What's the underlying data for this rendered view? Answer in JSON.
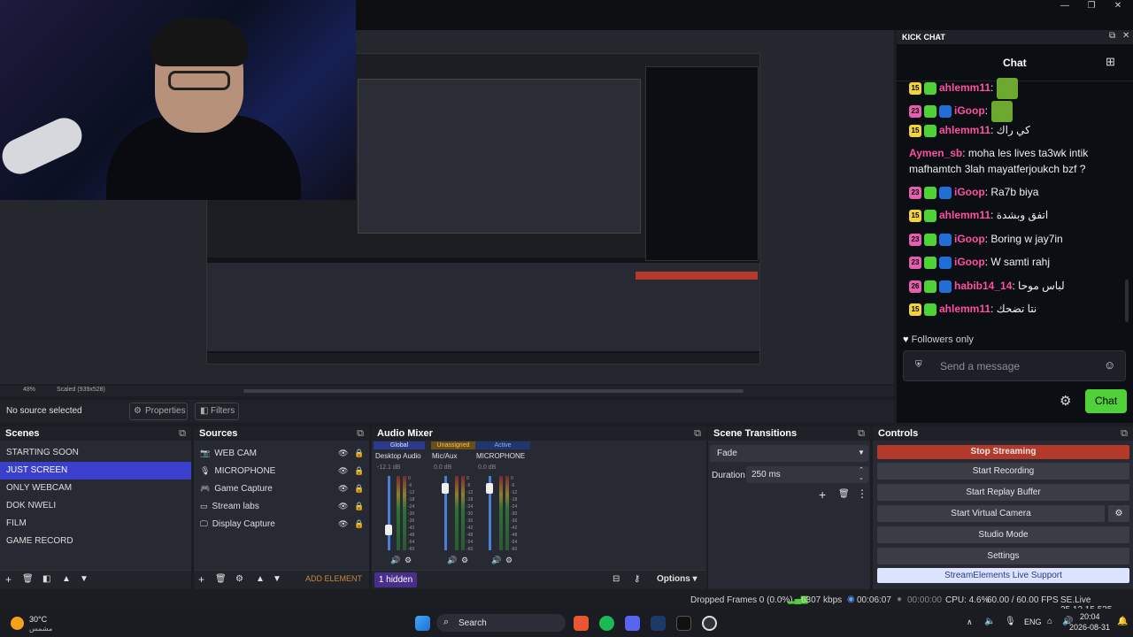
{
  "window": {
    "minimize": "—",
    "restore": "❐",
    "close": "✕"
  },
  "chat": {
    "dock_title": "KICK CHAT",
    "header": "Chat",
    "messages": [
      {
        "badge": "15",
        "badge_color": "#f2d33a",
        "user": "ahlemm11",
        "user_color": "#ff4fa3",
        "text": ":"
      },
      {
        "badge": "23",
        "badge_color": "#e75db0",
        "user": "iGoop",
        "user_color": "#ff4fa3",
        "text": ":"
      },
      {
        "badge": "15",
        "badge_color": "#f2d33a",
        "user": "ahlemm11",
        "user_color": "#ff4fa3",
        "text": ": كي راك"
      },
      {
        "badge": "",
        "badge_color": "",
        "user": "Aymen_sb",
        "user_color": "#ff4fa3",
        "text": ": moha les lives ta3wk intik"
      },
      {
        "badge": "",
        "badge_color": "",
        "user": "",
        "user_color": "",
        "text": "mafhamtch 3lah mayatferjoukch bzf ?"
      },
      {
        "badge": "23",
        "badge_color": "#e75db0",
        "user": "iGoop",
        "user_color": "#ff4fa3",
        "text": ": Ra7b biya"
      },
      {
        "badge": "15",
        "badge_color": "#f2d33a",
        "user": "ahlemm11",
        "user_color": "#ff4fa3",
        "text": ": اتفق وبشدة"
      },
      {
        "badge": "23",
        "badge_color": "#e75db0",
        "user": "iGoop",
        "user_color": "#ff4fa3",
        "text": ": Boring w jay7in"
      },
      {
        "badge": "23",
        "badge_color": "#e75db0",
        "user": "iGoop",
        "user_color": "#ff4fa3",
        "text": ": W samti rahj"
      },
      {
        "badge": "26",
        "badge_color": "#e75db0",
        "user": "habib14_14",
        "user_color": "#ff4fa3",
        "text": ": لباس موحا"
      },
      {
        "badge": "15",
        "badge_color": "#f2d33a",
        "user": "ahlemm11",
        "user_color": "#ff4fa3",
        "text": ": نتا تضحك"
      }
    ],
    "followers_only": "Followers only",
    "input_placeholder": "Send a message",
    "send_label": "Chat"
  },
  "preview": {
    "zoom": "48%",
    "scale": "Scaled (939x528)"
  },
  "sourcebar": {
    "status": "No source selected",
    "properties": "Properties",
    "filters": "Filters"
  },
  "scenes": {
    "title": "Scenes",
    "items": [
      "STARTING SOON",
      "JUST SCREEN",
      "ONLY WEBCAM",
      "DOK NWELI",
      "FILM",
      "GAME RECORD"
    ],
    "selected": "JUST SCREEN"
  },
  "sources": {
    "title": "Sources",
    "items": [
      "WEB CAM",
      "MICROPHONE",
      "Game Capture",
      "Stream labs",
      "Display Capture"
    ],
    "add_element": "ADD ELEMENT",
    "hidden": "1 hidden"
  },
  "mixer": {
    "title": "Audio Mixer",
    "groups": [
      "Global",
      "Unassigned",
      "Active"
    ],
    "channels": [
      {
        "name": "Desktop Audio",
        "db": "-12.1 dB",
        "level": 0.35
      },
      {
        "name": "Mic/Aux",
        "db": "0.0 dB",
        "level": 0.9
      },
      {
        "name": "MICROPHONE",
        "db": "0.0 dB",
        "level": 0.9
      }
    ],
    "scale": [
      "0",
      "-6",
      "-12",
      "-18",
      "-24",
      "-30",
      "-36",
      "-42",
      "-48",
      "-54",
      "-60"
    ],
    "options": "Options"
  },
  "transitions": {
    "title": "Scene Transitions",
    "selected": "Fade",
    "duration_label": "Duration",
    "duration": "250 ms"
  },
  "controls": {
    "title": "Controls",
    "stop_streaming": "Stop Streaming",
    "start_recording": "Start Recording",
    "start_replay": "Start Replay Buffer",
    "start_virtual": "Start Virtual Camera",
    "studio_mode": "Studio Mode",
    "settings": "Settings",
    "streamelements": "StreamElements Live Support"
  },
  "status": {
    "dropped": "Dropped Frames 0 (0.0%)",
    "kbps": "6307 kbps",
    "stream_time": "00:06:07",
    "rec_time": "00:00:00",
    "cpu": "CPU: 4.6%",
    "fps": "60.00 / 60.00 FPS",
    "version": "SE.Live 25.12.15.535"
  },
  "taskbar": {
    "weather_temp": "30°C",
    "weather_desc": "مشمس",
    "search": "Search",
    "lang": "ENG",
    "time": "20:04",
    "date": "2026-08-31"
  }
}
